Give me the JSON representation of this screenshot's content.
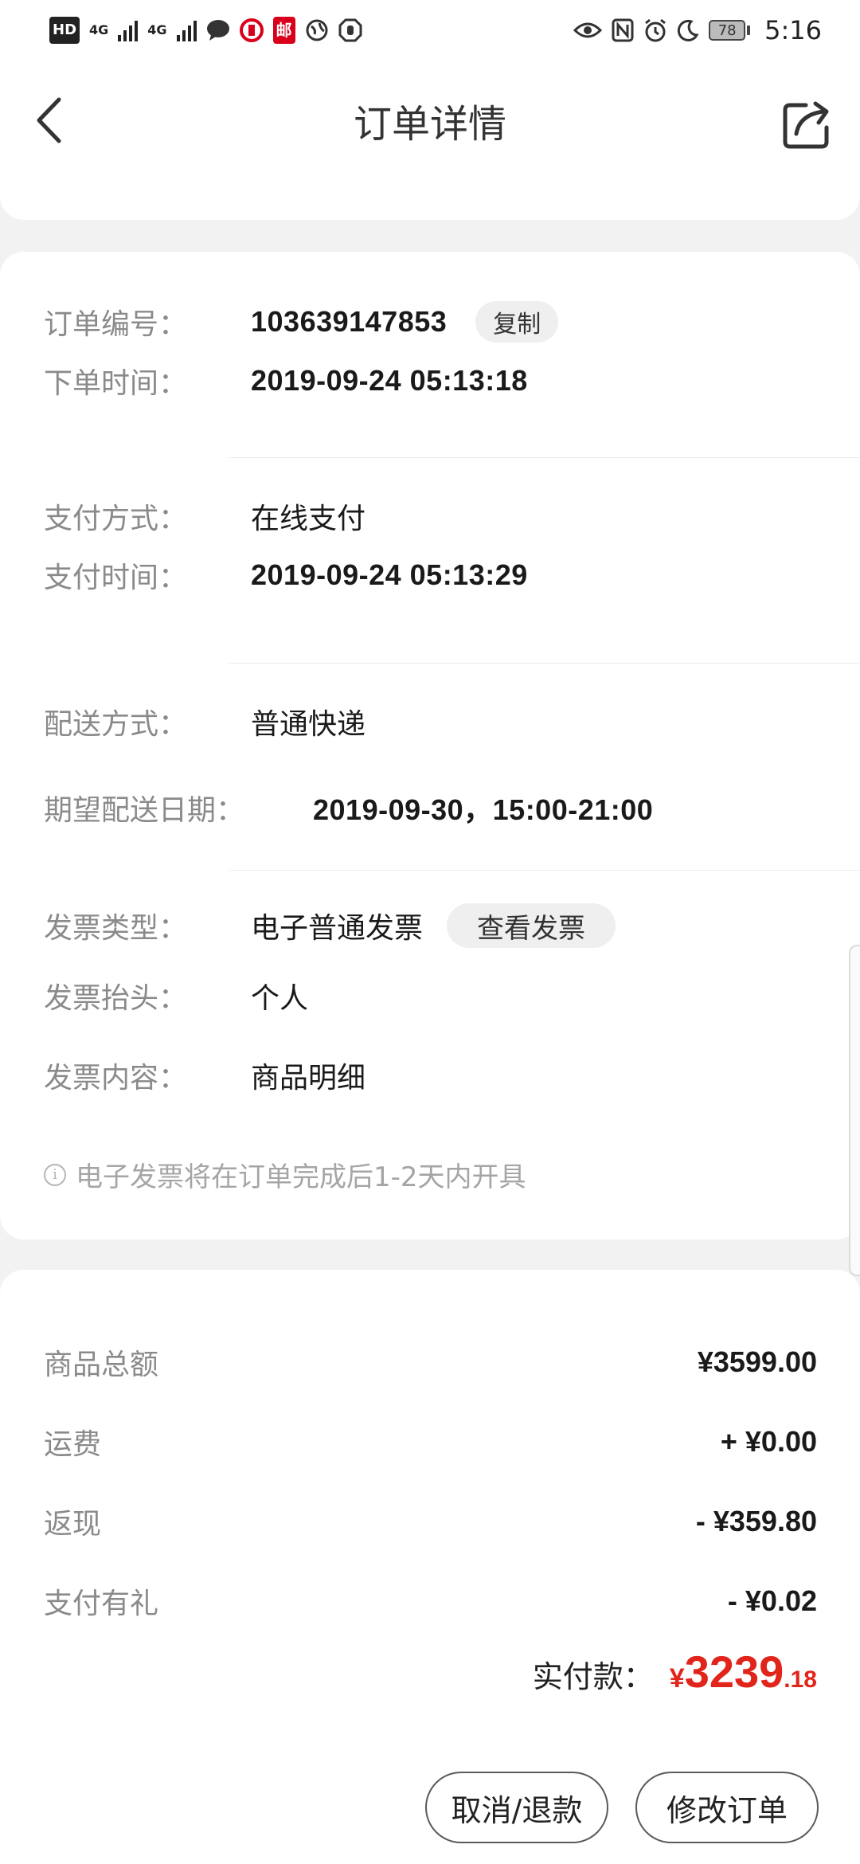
{
  "status_bar": {
    "hd": "HD",
    "net1": "4G",
    "net2": "4G",
    "mail_badge": "邮",
    "battery": "78",
    "time": "5:16"
  },
  "header": {
    "title": "订单详情"
  },
  "order_info": {
    "order_no_label": "订单编号：",
    "order_no": "103639147853",
    "copy_label": "复制",
    "order_time_label": "下单时间：",
    "order_time": "2019-09-24 05:13:18",
    "pay_method_label": "支付方式：",
    "pay_method": "在线支付",
    "pay_time_label": "支付时间：",
    "pay_time": "2019-09-24 05:13:29",
    "ship_method_label": "配送方式：",
    "ship_method": "普通快递",
    "expect_date_label": "期望配送日期：",
    "expect_date": "2019-09-30，15:00-21:00",
    "invoice_type_label": "发票类型：",
    "invoice_type": "电子普通发票",
    "view_invoice_label": "查看发票",
    "invoice_title_label": "发票抬头：",
    "invoice_title": "个人",
    "invoice_content_label": "发票内容：",
    "invoice_content": "商品明细",
    "invoice_note": "电子发票将在订单完成后1-2天内开具"
  },
  "amounts": {
    "goods_total_label": "商品总额",
    "goods_total": "¥3599.00",
    "shipping_label": "运费",
    "shipping": "+ ¥0.00",
    "cashback_label": "返现",
    "cashback": "- ¥359.80",
    "pay_gift_label": "支付有礼",
    "pay_gift": "- ¥0.02",
    "paid_label": "实付款：",
    "paid_currency": "¥",
    "paid_integer": "3239",
    "paid_decimal": ".18"
  },
  "actions": {
    "cancel_label": "取消/退款",
    "modify_label": "修改订单"
  }
}
